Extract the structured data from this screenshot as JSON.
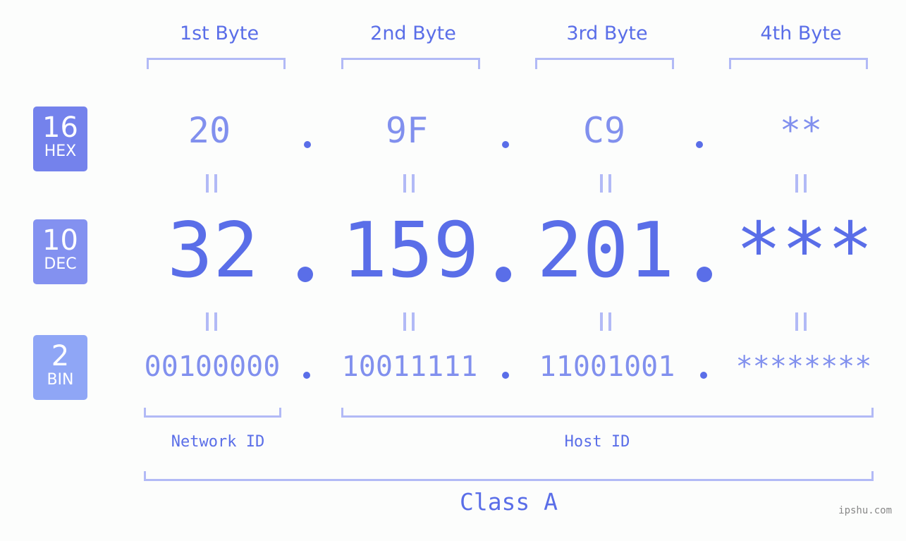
{
  "bytes": [
    {
      "header": "1st Byte",
      "hex": "20",
      "dec": "32",
      "bin": "00100000"
    },
    {
      "header": "2nd Byte",
      "hex": "9F",
      "dec": "159",
      "bin": "10011111"
    },
    {
      "header": "3rd Byte",
      "hex": "C9",
      "dec": "201",
      "bin": "11001001"
    },
    {
      "header": "4th Byte",
      "hex": "**",
      "dec": "***",
      "bin": "********"
    }
  ],
  "badges": {
    "hex": {
      "num": "16",
      "label": "HEX",
      "color": "#7482ec"
    },
    "dec": {
      "num": "10",
      "label": "DEC",
      "color": "#8391f0"
    },
    "bin": {
      "num": "2",
      "label": "BIN",
      "color": "#8fa6f6"
    }
  },
  "labels": {
    "network": "Network ID",
    "host": "Host ID",
    "class": "Class A"
  },
  "watermark": "ipshu.com",
  "colors": {
    "accent": "#5a6ee8",
    "light": "#8190ee",
    "bracket": "#b2baf6"
  }
}
